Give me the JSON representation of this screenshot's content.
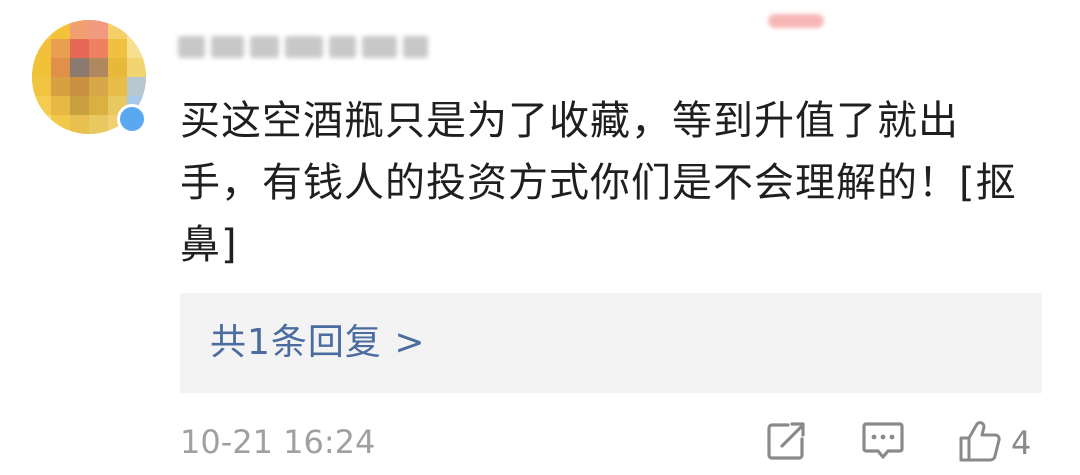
{
  "comment": {
    "text": "买这空酒瓶只是为了收藏，等到升值了就出手，有钱人的投资方式你们是不会理解的！[抠鼻]",
    "reply_summary": "共1条回复 >",
    "timestamp": "10-21 16:24",
    "like_count": "4"
  },
  "icons": {
    "share": "share-icon",
    "reply": "comment-icon",
    "like": "thumbs-up-icon"
  },
  "colors": {
    "text": "#1f1f1f",
    "link": "#4a6c9e",
    "meta": "#a0a0a0",
    "reply_bg": "#f3f3f3",
    "icon": "#8a8a8a"
  }
}
